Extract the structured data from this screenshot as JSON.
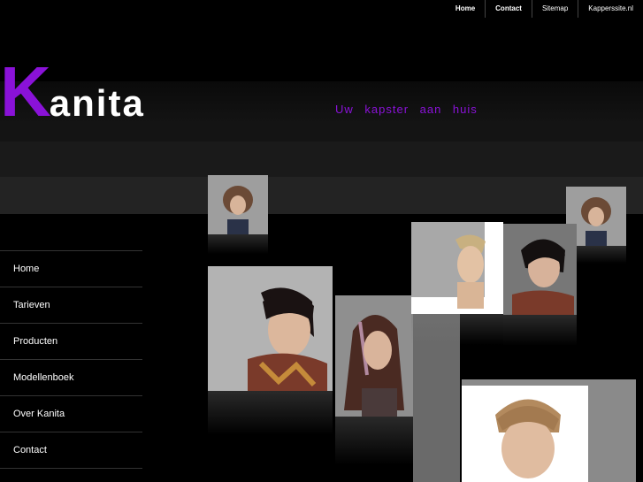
{
  "topnav": {
    "items": [
      {
        "label": "Home"
      },
      {
        "label": "Contact"
      },
      {
        "label": "Sitemap"
      },
      {
        "label": "Kapperssite.nl"
      }
    ]
  },
  "brand": {
    "initial": "K",
    "rest": "anita",
    "tagline": "Uw kapster aan huis",
    "accent_color": "#8a12d8"
  },
  "sidebar": {
    "items": [
      {
        "label": "Home"
      },
      {
        "label": "Tarieven"
      },
      {
        "label": "Producten"
      },
      {
        "label": "Modellenboek"
      },
      {
        "label": "Over Kanita"
      },
      {
        "label": "Contact"
      }
    ]
  }
}
